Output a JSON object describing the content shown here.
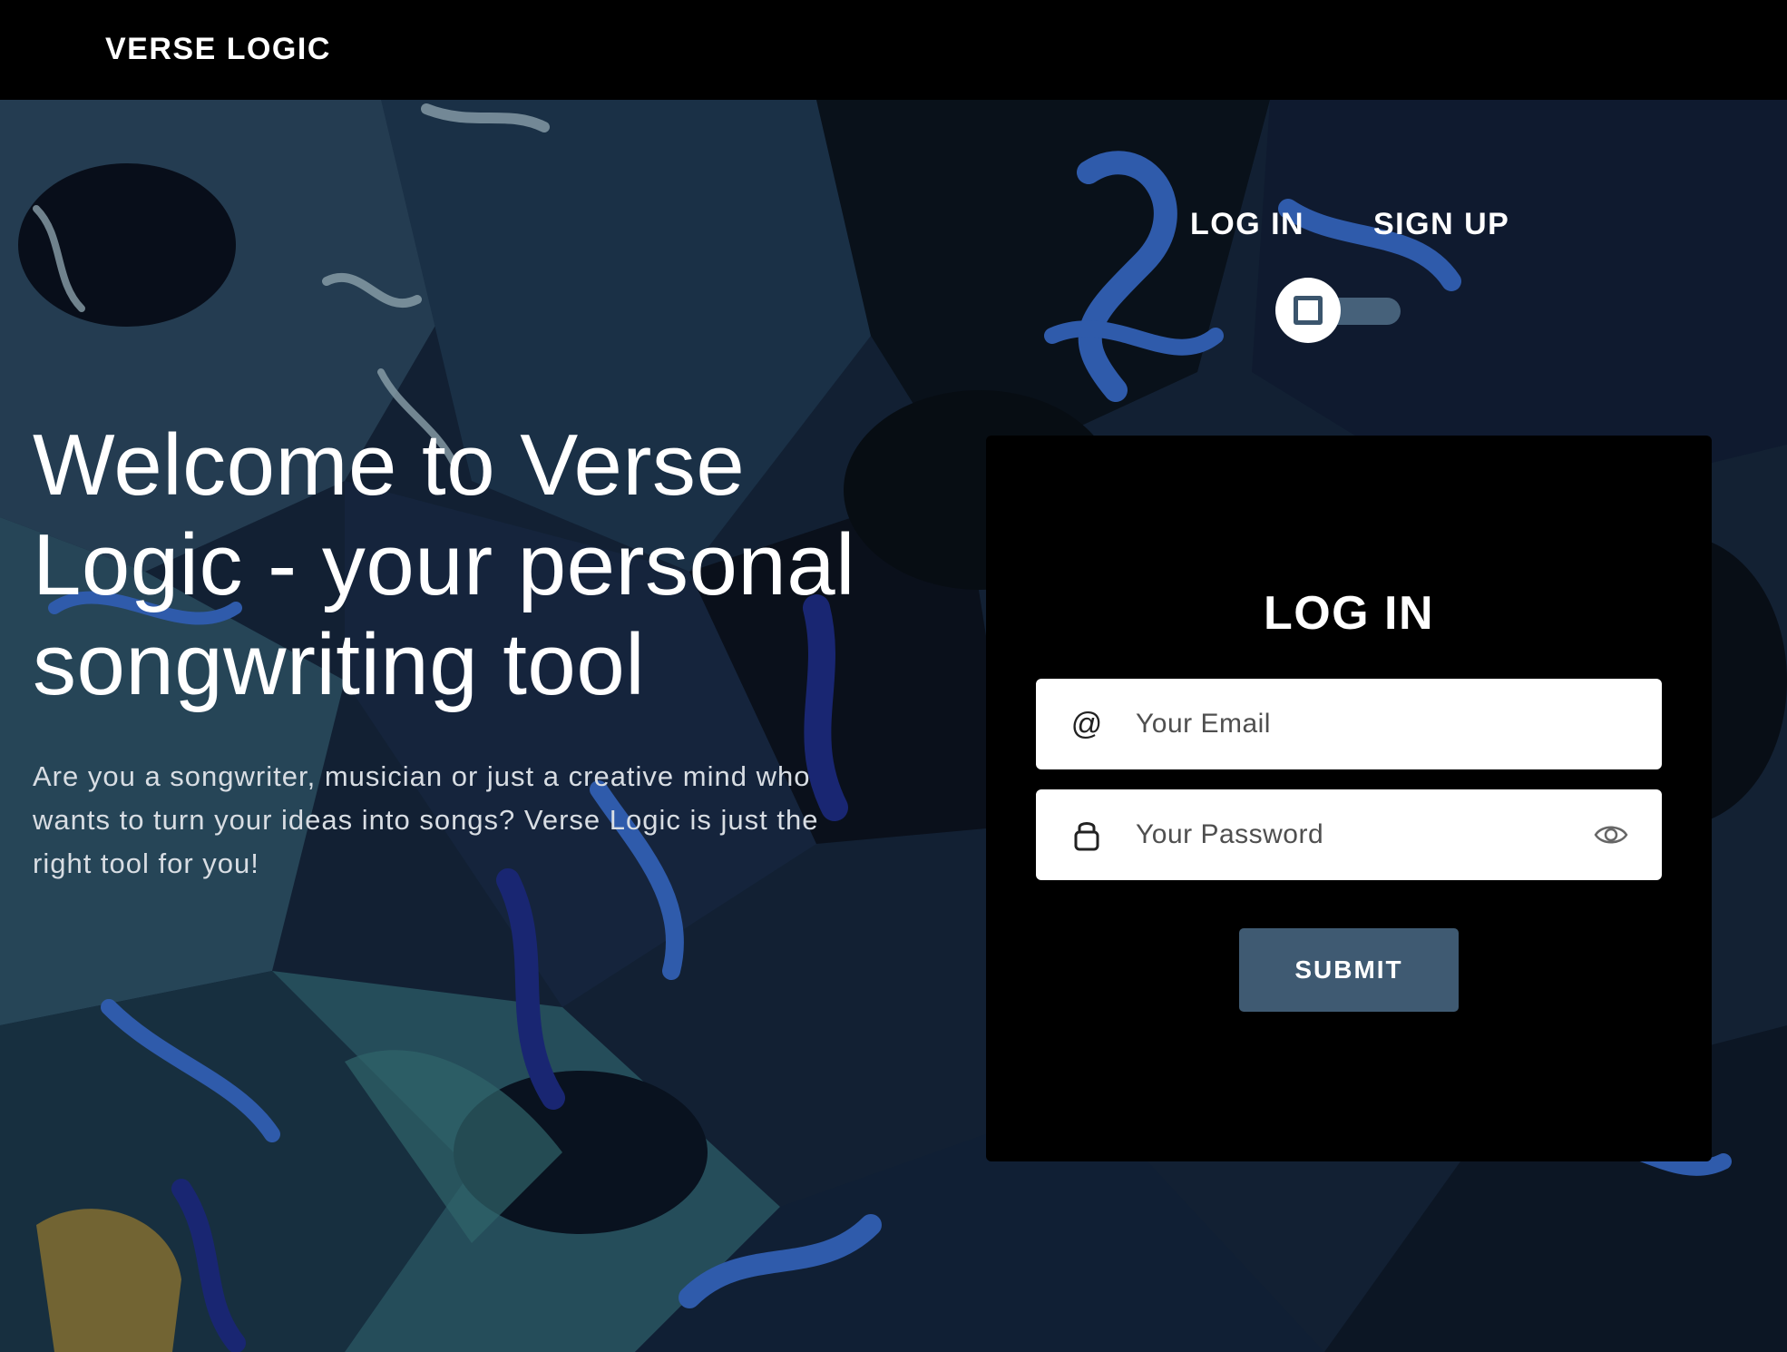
{
  "header": {
    "brand": "VERSE LOGIC"
  },
  "auth_tabs": {
    "login_label": "LOG IN",
    "signup_label": "SIGN UP"
  },
  "mode_toggle": {
    "state": "login"
  },
  "hero": {
    "title": "Welcome to Verse Logic - your personal songwriting tool",
    "subtitle": "Are you a songwriter, musician or just a creative mind who wants to turn your ideas into songs? Verse Logic is just the right tool for you!"
  },
  "login_form": {
    "title": "LOG IN",
    "email_icon": "@",
    "email_placeholder": "Your Email",
    "email_value": "",
    "password_placeholder": "Your Password",
    "password_value": "",
    "submit_label": "SUBMIT",
    "icons": {
      "email": "at-icon",
      "password": "lock-icon",
      "reveal": "eye-icon"
    }
  },
  "colors": {
    "topbar": "#000000",
    "card": "#000000",
    "submit": "#3f5a72",
    "toggle_track": "#46617a"
  }
}
